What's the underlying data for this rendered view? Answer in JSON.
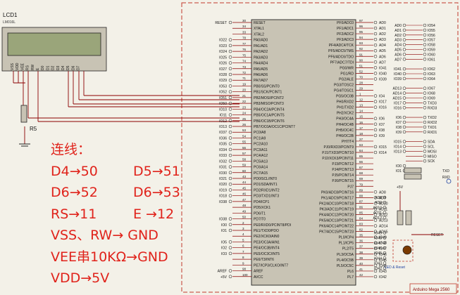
{
  "lcd": {
    "ref": "LCD1",
    "part": "LM016L",
    "pins": [
      "VSS",
      "VDD",
      "VEE",
      "RS",
      "RW",
      "E",
      "D0",
      "D1",
      "D2",
      "D3",
      "D4",
      "D5",
      "D6",
      "D7"
    ]
  },
  "resistor": {
    "ref": "R5"
  },
  "mcu": {
    "title": "Arduino Mega 2560",
    "left_pins": [
      {
        "name": "RESET",
        "num": "30",
        "net": "RESET"
      },
      {
        "name": "XTAL1",
        "num": "34",
        "net": ""
      },
      {
        "name": "XTAL2",
        "num": "33",
        "net": ""
      },
      {
        "name": "PA0/AD0",
        "num": "78",
        "net": "IO22"
      },
      {
        "name": "PA1/AD1",
        "num": "77",
        "net": "IO23"
      },
      {
        "name": "PA2/AD2",
        "num": "76",
        "net": "IO24"
      },
      {
        "name": "PA3/AD3",
        "num": "75",
        "net": "IO25"
      },
      {
        "name": "PA4/AD4",
        "num": "74",
        "net": "IO26"
      },
      {
        "name": "PA5/AD5",
        "num": "73",
        "net": "IO27"
      },
      {
        "name": "PA6/AD6",
        "num": "72",
        "net": "IO28"
      },
      {
        "name": "PA7/AD7",
        "num": "71",
        "net": "IO29"
      },
      {
        "name": "PB0/SS/PCINT0",
        "num": "19",
        "net": "IO53"
      },
      {
        "name": "PB1/SCK/PCINT1",
        "num": "20",
        "net": "IO52"
      },
      {
        "name": "PB2/MOSI/PCINT2",
        "num": "21",
        "net": "IO51"
      },
      {
        "name": "PB3/MISO/PCINT3",
        "num": "22",
        "net": "IO50"
      },
      {
        "name": "PB4/OC2A/PCINT4",
        "num": "23",
        "net": "IO10"
      },
      {
        "name": "PB5/OC1A/PCINT5",
        "num": "24",
        "net": "IO11"
      },
      {
        "name": "PB6/OC1B/PCINT6",
        "num": "25",
        "net": "IO12"
      },
      {
        "name": "PB7/OC0A/OC1C/PCINT7",
        "num": "26",
        "net": "IO13"
      },
      {
        "name": "PC0/A8",
        "num": "53",
        "net": "IO37"
      },
      {
        "name": "PC1/A9",
        "num": "54",
        "net": "IO36"
      },
      {
        "name": "PC2/A10",
        "num": "55",
        "net": "IO35"
      },
      {
        "name": "PC3/A11",
        "num": "56",
        "net": "IO34"
      },
      {
        "name": "PC4/A12",
        "num": "57",
        "net": "IO33"
      },
      {
        "name": "PC5/A13",
        "num": "58",
        "net": "IO32"
      },
      {
        "name": "PC6/A14",
        "num": "59",
        "net": "IO31"
      },
      {
        "name": "PC7/A15",
        "num": "60",
        "net": "IO30"
      },
      {
        "name": "PD0/SCL/INT0",
        "num": "43",
        "net": "IO21"
      },
      {
        "name": "PD1/SDA/INT1",
        "num": "44",
        "net": "IO20"
      },
      {
        "name": "PD2/RXD1/INT2",
        "num": "45",
        "net": "IO19"
      },
      {
        "name": "PD3/TXD1/INT3",
        "num": "46",
        "net": "IO18"
      },
      {
        "name": "PD4/ICP1",
        "num": "47",
        "net": "IO38"
      },
      {
        "name": "PD5/XCK1",
        "num": "48",
        "net": ""
      },
      {
        "name": "PD6/T1",
        "num": "49",
        "net": ""
      },
      {
        "name": "PD7/T0",
        "num": "50",
        "net": "IO38"
      },
      {
        "name": "PE0/RXD0/PCINT8/PDI",
        "num": "2",
        "net": "IO0"
      },
      {
        "name": "PE1/TXD0/PDO",
        "num": "3",
        "net": "IO1"
      },
      {
        "name": "PE2/XCK0/AIN0",
        "num": "4",
        "net": ""
      },
      {
        "name": "PE3/OC3A/AIN1",
        "num": "5",
        "net": "IO5"
      },
      {
        "name": "PE4/OC3B/INT4",
        "num": "6",
        "net": "IO2"
      },
      {
        "name": "PE5/OC3C/INT5",
        "num": "7",
        "net": "IO3"
      },
      {
        "name": "PE6/T3/INT6",
        "num": "8",
        "net": ""
      },
      {
        "name": "PE7/ICP3/CLKO/INT7",
        "num": "9",
        "net": ""
      },
      {
        "name": "AREF",
        "num": "98",
        "net": "AREF"
      },
      {
        "name": "AVCC",
        "num": "100",
        "net": "+5V"
      }
    ],
    "right_pins": [
      {
        "name": "PF0/ADC0",
        "num": "97",
        "net": "AD0"
      },
      {
        "name": "PF1/ADC1",
        "num": "96",
        "net": "AD1"
      },
      {
        "name": "PF2/ADC2",
        "num": "95",
        "net": "AD2"
      },
      {
        "name": "PF3/ADC3",
        "num": "94",
        "net": "AD3"
      },
      {
        "name": "PF4/ADC4/TCK",
        "num": "93",
        "net": "AD4"
      },
      {
        "name": "PF5/ADC5/TMS",
        "num": "92",
        "net": "AD5"
      },
      {
        "name": "PF6/ADC6/TDO",
        "num": "91",
        "net": "AD6"
      },
      {
        "name": "PF7/ADC7/TDI",
        "num": "90",
        "net": "AD7"
      },
      {
        "name": "PG0/WR",
        "num": "51",
        "net": "IO41"
      },
      {
        "name": "PG1/RD",
        "num": "52",
        "net": "IO40"
      },
      {
        "name": "PG2/ALE",
        "num": "70",
        "net": "IO39"
      },
      {
        "name": "PG3/TOSC2",
        "num": "28",
        "net": ""
      },
      {
        "name": "PG4/TOSC1",
        "num": "29",
        "net": ""
      },
      {
        "name": "PG5/OC0B",
        "num": "1",
        "net": "IO4"
      },
      {
        "name": "PH0/RXD2",
        "num": "12",
        "net": "IO17"
      },
      {
        "name": "PH1/TXD2",
        "num": "13",
        "net": "IO16"
      },
      {
        "name": "PH2/XCK2",
        "num": "14",
        "net": ""
      },
      {
        "name": "PH3/OC4A",
        "num": "15",
        "net": "IO6"
      },
      {
        "name": "PH4/OC4B",
        "num": "16",
        "net": "IO7"
      },
      {
        "name": "PH5/OC4C",
        "num": "17",
        "net": "IO8"
      },
      {
        "name": "PH6/OC2B",
        "num": "18",
        "net": "IO9"
      },
      {
        "name": "PH7/T4",
        "num": "27",
        "net": ""
      },
      {
        "name": "PJ0/RXD3/PCINT9",
        "num": "63",
        "net": "IO15"
      },
      {
        "name": "PJ1/TXD3/PCINT10",
        "num": "64",
        "net": "IO14"
      },
      {
        "name": "PJ2/XCK3/PCINT11",
        "num": "65",
        "net": ""
      },
      {
        "name": "PJ3/PCINT12",
        "num": "66",
        "net": ""
      },
      {
        "name": "PJ4/PCINT13",
        "num": "67",
        "net": ""
      },
      {
        "name": "PJ5/PCINT14",
        "num": "68",
        "net": ""
      },
      {
        "name": "PJ6/PCINT15",
        "num": "69",
        "net": ""
      },
      {
        "name": "PJ7",
        "num": "79",
        "net": ""
      },
      {
        "name": "PK0/ADC8/PCINT16",
        "num": "89",
        "net": "AD8"
      },
      {
        "name": "PK1/ADC9/PCINT17",
        "num": "88",
        "net": "AD9"
      },
      {
        "name": "PK2/ADC10/PCINT18",
        "num": "87",
        "net": "AD10"
      },
      {
        "name": "PK3/ADC11/PCINT19",
        "num": "86",
        "net": "AD11"
      },
      {
        "name": "PK4/ADC12/PCINT20",
        "num": "85",
        "net": "AD12"
      },
      {
        "name": "PK5/ADC13/PCINT21",
        "num": "84",
        "net": "AD13"
      },
      {
        "name": "PK6/ADC14/PCINT22",
        "num": "83",
        "net": "AD14"
      },
      {
        "name": "PK7/ADC15/PCINT23",
        "num": "82",
        "net": "AD15"
      },
      {
        "name": "PL0/ICP4",
        "num": "35",
        "net": "IO49"
      },
      {
        "name": "PL1/ICP5",
        "num": "36",
        "net": "IO48"
      },
      {
        "name": "PL2/T5",
        "num": "37",
        "net": "IO47"
      },
      {
        "name": "PL3/OC5A",
        "num": "38",
        "net": "IO46"
      },
      {
        "name": "PL4/OC5B",
        "num": "39",
        "net": "IO45"
      },
      {
        "name": "PL5/OC5C",
        "num": "40",
        "net": "IO44"
      },
      {
        "name": "PL6",
        "num": "41",
        "net": "IO43"
      },
      {
        "name": "PL7",
        "num": "42",
        "net": "IO42"
      }
    ]
  },
  "header_nets": {
    "col1": [
      "AD0",
      "AD1",
      "AD2",
      "AD3",
      "AD4",
      "AD5",
      "AD6",
      "AD7",
      "",
      "IO41",
      "IO40",
      "IO39",
      "",
      "AD13",
      "AD14",
      "AD15",
      "IO17",
      "IO16",
      "",
      "IO6",
      "IO7",
      "IO8",
      "IO9",
      "",
      "IO15",
      "IO14",
      "IO13",
      "",
      "",
      "IO0",
      "IO1"
    ],
    "col2": [
      "IO54",
      "IO55",
      "IO56",
      "IO57",
      "IO58",
      "IO59",
      "IO60",
      "IO61",
      "",
      "IO62",
      "IO63",
      "IO64",
      "",
      "IO67",
      "IO68",
      "IO69",
      "TXD3",
      "RXD3",
      "",
      "TXD2",
      "RXD2",
      "TXD1",
      "RXD1",
      "",
      "SDA",
      "SCL",
      "MOSI",
      "MISO",
      "SCK",
      "",
      ""
    ],
    "bottom_col1": [
      "AD8",
      "AD9",
      "AD10",
      "AD11",
      "AD12",
      "",
      "",
      "IO49",
      "IO48",
      "IO47",
      "IO46",
      "IO45",
      "IO44",
      "IO43",
      "IO42"
    ]
  },
  "power": {
    "vcc": "+5V",
    "reset": "RESET",
    "txd": "TXD",
    "rxd": "RXD"
  },
  "led_label": "LED & Reset",
  "board_label": "Arduino Mega 2560",
  "notes": {
    "title": "连线：",
    "lines": [
      [
        "D4→50",
        "D5→51"
      ],
      [
        "D6→52",
        "D6→53"
      ],
      [
        "RS→11",
        "E →12"
      ],
      [
        "VSS、RW→ GND",
        ""
      ],
      [
        "VEE串10KΩ→GND",
        ""
      ],
      [
        "VDD→5V",
        ""
      ]
    ]
  },
  "colors": {
    "wire": "#8b0000",
    "part_fill": "#c8c3b4",
    "lcd_screen": "#9aa57a",
    "note_text": "#e0231b",
    "frame_dash": "#c0392b"
  }
}
